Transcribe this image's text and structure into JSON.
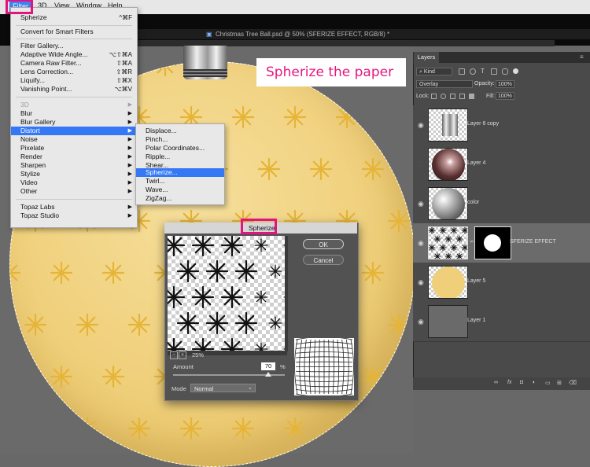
{
  "menubar": {
    "items": [
      "Filter",
      "3D",
      "View",
      "Window",
      "Help"
    ]
  },
  "document": {
    "tab_title": "Christmas Tree Ball.psd @ 50% (SFERIZE EFFECT, RGB/8) *"
  },
  "annotation": {
    "text": "Spherize the paper",
    "color": "#e6177f"
  },
  "filter_menu": {
    "items": [
      {
        "label": "Spherize",
        "shortcut": "^⌘F"
      },
      {
        "label": "Convert for Smart Filters"
      },
      {
        "label": "Filter Gallery..."
      },
      {
        "label": "Adaptive Wide Angle...",
        "shortcut": "⌥⇧⌘A"
      },
      {
        "label": "Camera Raw Filter...",
        "shortcut": "⇧⌘A"
      },
      {
        "label": "Lens Correction...",
        "shortcut": "⇧⌘R"
      },
      {
        "label": "Liquify...",
        "shortcut": "⇧⌘X"
      },
      {
        "label": "Vanishing Point...",
        "shortcut": "⌥⌘V"
      },
      {
        "label": "3D"
      },
      {
        "label": "Blur"
      },
      {
        "label": "Blur Gallery"
      },
      {
        "label": "Distort"
      },
      {
        "label": "Noise"
      },
      {
        "label": "Pixelate"
      },
      {
        "label": "Render"
      },
      {
        "label": "Sharpen"
      },
      {
        "label": "Stylize"
      },
      {
        "label": "Video"
      },
      {
        "label": "Other"
      },
      {
        "label": "Topaz Labs"
      },
      {
        "label": "Topaz Studio"
      }
    ]
  },
  "distort_menu": {
    "items": [
      "Displace...",
      "Pinch...",
      "Polar Coordinates...",
      "Ripple...",
      "Shear...",
      "Spherize...",
      "Twirl...",
      "Wave...",
      "ZigZag..."
    ],
    "selected": "Spherize..."
  },
  "dialog": {
    "title": "Spherize",
    "ok_label": "OK",
    "cancel_label": "Cancel",
    "zoom": "25%",
    "zoom_minus": "−",
    "zoom_plus": "+",
    "amount_label": "Amount",
    "amount_value": "70",
    "amount_unit": "%",
    "amount_fraction": 0.85,
    "mode_label": "Mode",
    "mode_value": "Normal"
  },
  "layers_panel": {
    "tab_label": "Layers",
    "kind_label": "Kind",
    "blend_mode": "Overlay",
    "opacity_label": "Opacity:",
    "opacity_value": "100%",
    "lock_label": "Lock:",
    "fill_label": "Fill:",
    "fill_value": "100%",
    "layers": [
      {
        "name": "Layer 6 copy",
        "visible": true
      },
      {
        "name": "Layer 4",
        "visible": false
      },
      {
        "name": "color",
        "visible": true
      },
      {
        "name": "SFERIZE EFFECT",
        "visible": true,
        "active": true
      },
      {
        "name": "Layer 5",
        "visible": true
      },
      {
        "name": "Layer 1",
        "visible": true
      }
    ]
  },
  "colors": {
    "highlight_box": "#e4147d",
    "menu_selection": "#3478f6",
    "ornament": "#efcf7a",
    "star_pattern": "#e6b537"
  }
}
